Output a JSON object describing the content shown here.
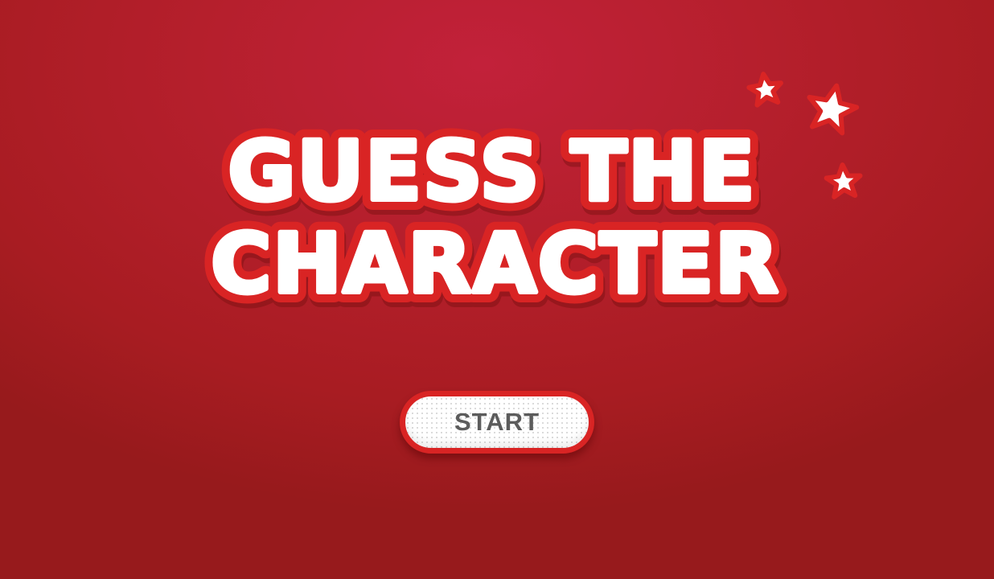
{
  "title": {
    "line1": "GUESS THE",
    "line2": "CHARACTER"
  },
  "start_button": {
    "label": "START"
  },
  "decorations": {
    "stars": [
      "star-icon",
      "star-icon",
      "star-icon"
    ]
  },
  "colors": {
    "background": "#b51f2c",
    "title_fill": "#ffffff",
    "title_outline": "#d92424",
    "button_border": "#d92424",
    "button_text": "#5c5c5c"
  }
}
